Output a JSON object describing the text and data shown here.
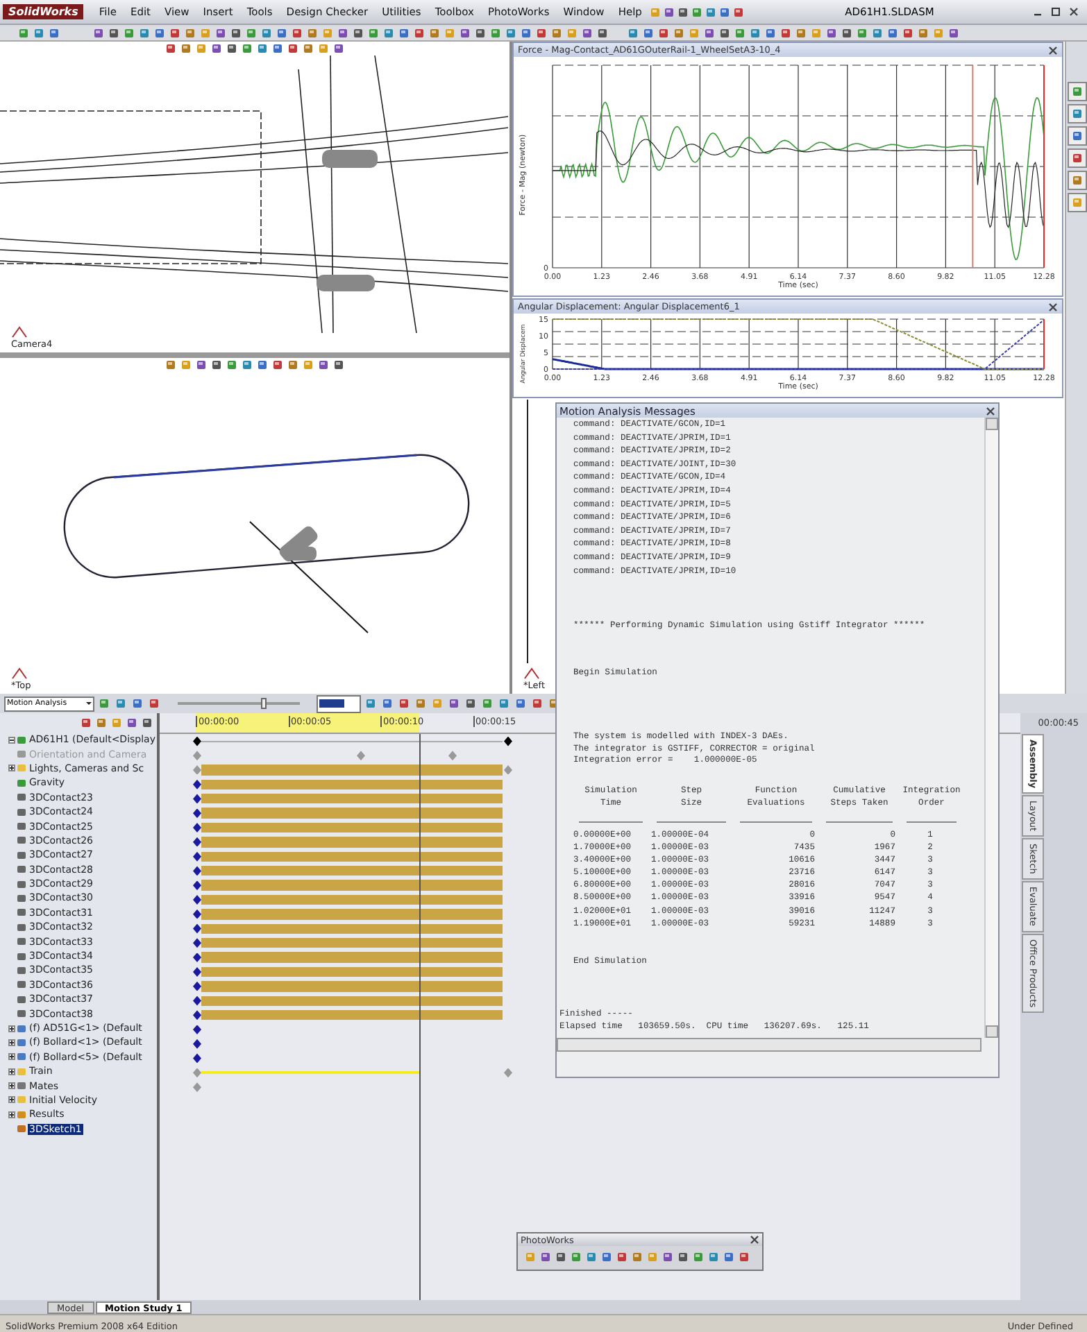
{
  "window": {
    "logo": "SolidWorks",
    "title": "AD61H1.SLDASM"
  },
  "menu": [
    "File",
    "Edit",
    "View",
    "Insert",
    "Tools",
    "Design Checker",
    "Utilities",
    "Toolbox",
    "PhotoWorks",
    "Window",
    "Help"
  ],
  "viewports": [
    {
      "label": "Camera4",
      "kind": "rails"
    },
    {
      "label": "*Top",
      "kind": "oval"
    },
    {
      "label": "*Left",
      "kind": "line"
    }
  ],
  "force_chart": {
    "title": "Force - Mag-Contact_AD61GOuterRail-1_WheelSetA3-10_4",
    "ylabel": "Force - Mag (newton)",
    "xlabel": "Time (sec)",
    "yticks": [
      "0"
    ],
    "xticks": [
      "0.00",
      "1.23",
      "2.46",
      "3.68",
      "4.91",
      "6.14",
      "7.37",
      "8.60",
      "9.82",
      "11.05",
      "12.28"
    ]
  },
  "angle_chart": {
    "title": "Angular Displacement: Angular Displacement6_1",
    "ylabel": "Angular Displacem",
    "xlabel": "Time (sec)",
    "yticks": [
      "15",
      "10",
      "5",
      "0"
    ],
    "xticks": [
      "0.00",
      "1.23",
      "2.46",
      "3.68",
      "4.91",
      "6.14",
      "7.37",
      "8.60",
      "9.82",
      "11.05",
      "12.28"
    ]
  },
  "messages": {
    "title": "Motion Analysis Messages",
    "log": [
      "command: DEACTIVATE/GCON,ID=1",
      "command: DEACTIVATE/JPRIM,ID=1",
      "command: DEACTIVATE/JPRIM,ID=2",
      "command: DEACTIVATE/JOINT,ID=30",
      "command: DEACTIVATE/GCON,ID=4",
      "command: DEACTIVATE/JPRIM,ID=4",
      "command: DEACTIVATE/JPRIM,ID=5",
      "command: DEACTIVATE/JPRIM,ID=6",
      "command: DEACTIVATE/JPRIM,ID=7",
      "command: DEACTIVATE/JPRIM,ID=8",
      "command: DEACTIVATE/JPRIM,ID=9",
      "command: DEACTIVATE/JPRIM,ID=10"
    ],
    "banner": "****** Performing Dynamic Simulation using Gstiff Integrator ******",
    "begin": "Begin Simulation",
    "info": [
      "The system is modelled with INDEX-3 DAEs.",
      "The integrator is GSTIFF, CORRECTOR = original",
      "Integration error =    1.000000E-05"
    ],
    "columns": [
      "Simulation\nTime",
      "Step\nSize",
      "Function\nEvaluations",
      "Cumulative\nSteps Taken",
      "Integration\nOrder"
    ],
    "rows": [
      [
        "0.00000E+00",
        "1.00000E-04",
        "0",
        "0",
        "1"
      ],
      [
        "1.70000E+00",
        "1.00000E-03",
        "7435",
        "1967",
        "2"
      ],
      [
        "3.40000E+00",
        "1.00000E-03",
        "10616",
        "3447",
        "3"
      ],
      [
        "5.10000E+00",
        "1.00000E-03",
        "23716",
        "6147",
        "3"
      ],
      [
        "6.80000E+00",
        "1.00000E-03",
        "28016",
        "7047",
        "3"
      ],
      [
        "8.50000E+00",
        "1.00000E-03",
        "33916",
        "9547",
        "4"
      ],
      [
        "1.02000E+01",
        "1.00000E-03",
        "39016",
        "11247",
        "3"
      ],
      [
        "1.19000E+01",
        "1.00000E-03",
        "59231",
        "14889",
        "3"
      ]
    ],
    "end": "End Simulation",
    "finish": [
      "Finished -----",
      "Elapsed time   103659.50s.  CPU time   136207.69s.   125.11"
    ]
  },
  "motion": {
    "study_type": "Motion Analysis",
    "slider": {
      "level": 0.71
    },
    "time_marks": [
      "00:00:00",
      "00:00:05",
      "00:00:10",
      "00:00:15"
    ],
    "time_cursor": {
      "level": 0.3
    },
    "far_mark": "00:00:45",
    "tree": [
      {
        "label": "AD61H1 (Default<Display",
        "kind": "assembly",
        "expanded": true,
        "selected": false,
        "timeline": {
          "kind": "span"
        }
      },
      {
        "label": "Orientation and Camera",
        "kind": "camera",
        "selected": false,
        "timeline": {
          "kind": "camera"
        }
      },
      {
        "label": "Lights, Cameras and Sc",
        "kind": "folder",
        "expanded": false,
        "selected": false,
        "timeline": {
          "kind": "bar_grey"
        }
      },
      {
        "label": "Gravity",
        "kind": "gravity",
        "selected": false,
        "timeline": {
          "kind": "bar"
        }
      },
      {
        "label": "3DContact23",
        "kind": "contact",
        "selected": false,
        "timeline": {
          "kind": "bar"
        }
      },
      {
        "label": "3DContact24",
        "kind": "contact",
        "selected": false,
        "timeline": {
          "kind": "bar"
        }
      },
      {
        "label": "3DContact25",
        "kind": "contact",
        "selected": false,
        "timeline": {
          "kind": "bar"
        }
      },
      {
        "label": "3DContact26",
        "kind": "contact",
        "selected": false,
        "timeline": {
          "kind": "bar"
        }
      },
      {
        "label": "3DContact27",
        "kind": "contact",
        "selected": false,
        "timeline": {
          "kind": "bar"
        }
      },
      {
        "label": "3DContact28",
        "kind": "contact",
        "selected": false,
        "timeline": {
          "kind": "bar"
        }
      },
      {
        "label": "3DContact29",
        "kind": "contact",
        "selected": false,
        "timeline": {
          "kind": "bar"
        }
      },
      {
        "label": "3DContact30",
        "kind": "contact",
        "selected": false,
        "timeline": {
          "kind": "bar"
        }
      },
      {
        "label": "3DContact31",
        "kind": "contact",
        "selected": false,
        "timeline": {
          "kind": "bar"
        }
      },
      {
        "label": "3DContact32",
        "kind": "contact",
        "selected": false,
        "timeline": {
          "kind": "bar"
        }
      },
      {
        "label": "3DContact33",
        "kind": "contact",
        "selected": false,
        "timeline": {
          "kind": "bar"
        }
      },
      {
        "label": "3DContact34",
        "kind": "contact",
        "selected": false,
        "timeline": {
          "kind": "bar"
        }
      },
      {
        "label": "3DContact35",
        "kind": "contact",
        "selected": false,
        "timeline": {
          "kind": "bar"
        }
      },
      {
        "label": "3DContact36",
        "kind": "contact",
        "selected": false,
        "timeline": {
          "kind": "bar"
        }
      },
      {
        "label": "3DContact37",
        "kind": "contact",
        "selected": false,
        "timeline": {
          "kind": "bar"
        }
      },
      {
        "label": "3DContact38",
        "kind": "contact",
        "selected": false,
        "timeline": {
          "kind": "bar"
        }
      },
      {
        "label": "(f) AD51G<1> (Default",
        "kind": "part",
        "expanded": false,
        "selected": false,
        "timeline": {
          "kind": "key"
        }
      },
      {
        "label": "(f) Bollard<1> (Default",
        "kind": "part",
        "expanded": false,
        "selected": false,
        "timeline": {
          "kind": "key"
        }
      },
      {
        "label": "(f) Bollard<5> (Default",
        "kind": "part",
        "expanded": false,
        "selected": false,
        "timeline": {
          "kind": "key"
        }
      },
      {
        "label": "Train",
        "kind": "folder",
        "expanded": false,
        "selected": false,
        "timeline": {
          "kind": "line"
        }
      },
      {
        "label": "Mates",
        "kind": "mates",
        "expanded": false,
        "selected": false,
        "timeline": {
          "kind": "key_grey"
        }
      },
      {
        "label": "Initial Velocity",
        "kind": "folder",
        "expanded": false,
        "selected": false,
        "timeline": {
          "kind": "none"
        }
      },
      {
        "label": "Results",
        "kind": "results",
        "expanded": false,
        "selected": false,
        "timeline": {
          "kind": "none"
        }
      },
      {
        "label": "3DSketch1",
        "kind": "sketch",
        "selected": true,
        "timeline": {
          "kind": "none"
        }
      }
    ]
  },
  "side_tabs": [
    {
      "label": "Assembly",
      "selected": true
    },
    {
      "label": "Layout",
      "selected": false
    },
    {
      "label": "Sketch",
      "selected": false
    },
    {
      "label": "Evaluate",
      "selected": false
    },
    {
      "label": "Office Products",
      "selected": false
    }
  ],
  "bottom_tabs": [
    {
      "label": "Model",
      "selected": false
    },
    {
      "label": "Motion Study 1",
      "selected": true
    }
  ],
  "photoworks": {
    "title": "PhotoWorks"
  },
  "status_bar": {
    "product": "SolidWorks Premium 2008 x64 Edition",
    "state": "Under Defined"
  }
}
